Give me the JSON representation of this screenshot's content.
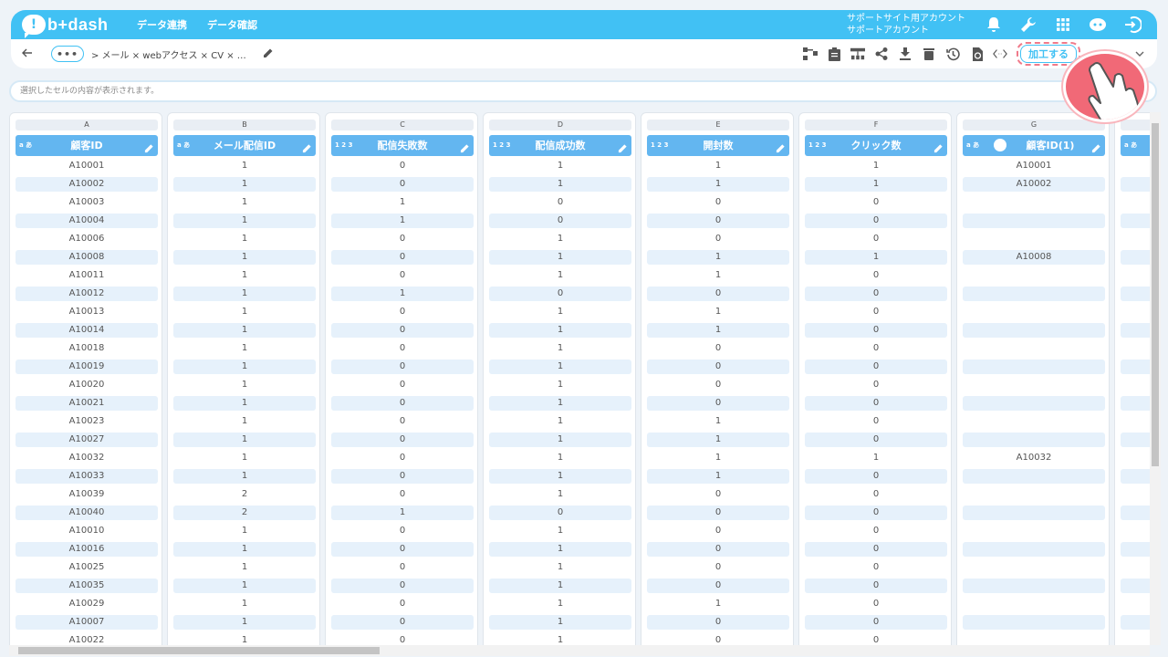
{
  "app": {
    "logo_text": "b+dash",
    "nav": [
      "データ連携",
      "データ確認"
    ],
    "account_line1": "サポートサイト用アカウント",
    "account_line2": "サポートアカウント"
  },
  "toolbar": {
    "breadcrumb_dots": "•••",
    "breadcrumb_text": "> メール × webアクセス × CV × …",
    "process_button": "加工する"
  },
  "cellbar": {
    "placeholder": "選択したセルの内容が表示されます。"
  },
  "columns": [
    {
      "letter": "A",
      "type": "a あ",
      "name": "顧客ID"
    },
    {
      "letter": "B",
      "type": "a あ",
      "name": "メール配信ID"
    },
    {
      "letter": "C",
      "type": "1 2 3",
      "name": "配信失敗数"
    },
    {
      "letter": "D",
      "type": "1 2 3",
      "name": "配信成功数"
    },
    {
      "letter": "E",
      "type": "1 2 3",
      "name": "開封数"
    },
    {
      "letter": "F",
      "type": "1 2 3",
      "name": "クリック数"
    },
    {
      "letter": "G",
      "type": "a あ",
      "name": "顧客ID(1)"
    },
    {
      "letter": "",
      "type": "a あ",
      "name": ""
    }
  ],
  "rows": [
    [
      "A10001",
      "1",
      "0",
      "1",
      "1",
      "1",
      "A10001"
    ],
    [
      "A10002",
      "1",
      "0",
      "1",
      "1",
      "1",
      "A10002"
    ],
    [
      "A10003",
      "1",
      "1",
      "0",
      "0",
      "0",
      ""
    ],
    [
      "A10004",
      "1",
      "1",
      "0",
      "0",
      "0",
      ""
    ],
    [
      "A10006",
      "1",
      "0",
      "1",
      "0",
      "0",
      ""
    ],
    [
      "A10008",
      "1",
      "0",
      "1",
      "1",
      "1",
      "A10008"
    ],
    [
      "A10011",
      "1",
      "0",
      "1",
      "1",
      "0",
      ""
    ],
    [
      "A10012",
      "1",
      "1",
      "0",
      "0",
      "0",
      ""
    ],
    [
      "A10013",
      "1",
      "0",
      "1",
      "1",
      "0",
      ""
    ],
    [
      "A10014",
      "1",
      "0",
      "1",
      "1",
      "0",
      ""
    ],
    [
      "A10018",
      "1",
      "0",
      "1",
      "0",
      "0",
      ""
    ],
    [
      "A10019",
      "1",
      "0",
      "1",
      "0",
      "0",
      ""
    ],
    [
      "A10020",
      "1",
      "0",
      "1",
      "0",
      "0",
      ""
    ],
    [
      "A10021",
      "1",
      "0",
      "1",
      "0",
      "0",
      ""
    ],
    [
      "A10023",
      "1",
      "0",
      "1",
      "1",
      "0",
      ""
    ],
    [
      "A10027",
      "1",
      "0",
      "1",
      "1",
      "0",
      ""
    ],
    [
      "A10032",
      "1",
      "0",
      "1",
      "1",
      "1",
      "A10032"
    ],
    [
      "A10033",
      "1",
      "0",
      "1",
      "1",
      "0",
      ""
    ],
    [
      "A10039",
      "2",
      "0",
      "1",
      "0",
      "0",
      ""
    ],
    [
      "A10040",
      "2",
      "1",
      "0",
      "0",
      "0",
      ""
    ],
    [
      "A10010",
      "1",
      "0",
      "1",
      "0",
      "0",
      ""
    ],
    [
      "A10016",
      "1",
      "0",
      "1",
      "0",
      "0",
      ""
    ],
    [
      "A10025",
      "1",
      "0",
      "1",
      "0",
      "0",
      ""
    ],
    [
      "A10035",
      "1",
      "0",
      "1",
      "0",
      "0",
      ""
    ],
    [
      "A10029",
      "1",
      "0",
      "1",
      "1",
      "0",
      ""
    ],
    [
      "A10007",
      "1",
      "0",
      "1",
      "0",
      "0",
      ""
    ],
    [
      "A10022",
      "1",
      "0",
      "1",
      "0",
      "0",
      ""
    ]
  ],
  "colors": {
    "accent": "#41c1f4",
    "header": "#63b6f0",
    "row_alt": "#e6f1fb",
    "highlight": "#f16977"
  },
  "icons": [
    "bell-icon",
    "wrench-icon",
    "apps-grid-icon",
    "support-bot-icon",
    "logout-icon",
    "back-arrow-icon",
    "pencil-icon",
    "flow-icon",
    "clipboard-icon",
    "hierarchy-icon",
    "share-icon",
    "download-icon",
    "trash-icon",
    "history-icon",
    "refresh-icon",
    "code-icon",
    "chevron-down-icon",
    "pointer-hand-icon"
  ]
}
